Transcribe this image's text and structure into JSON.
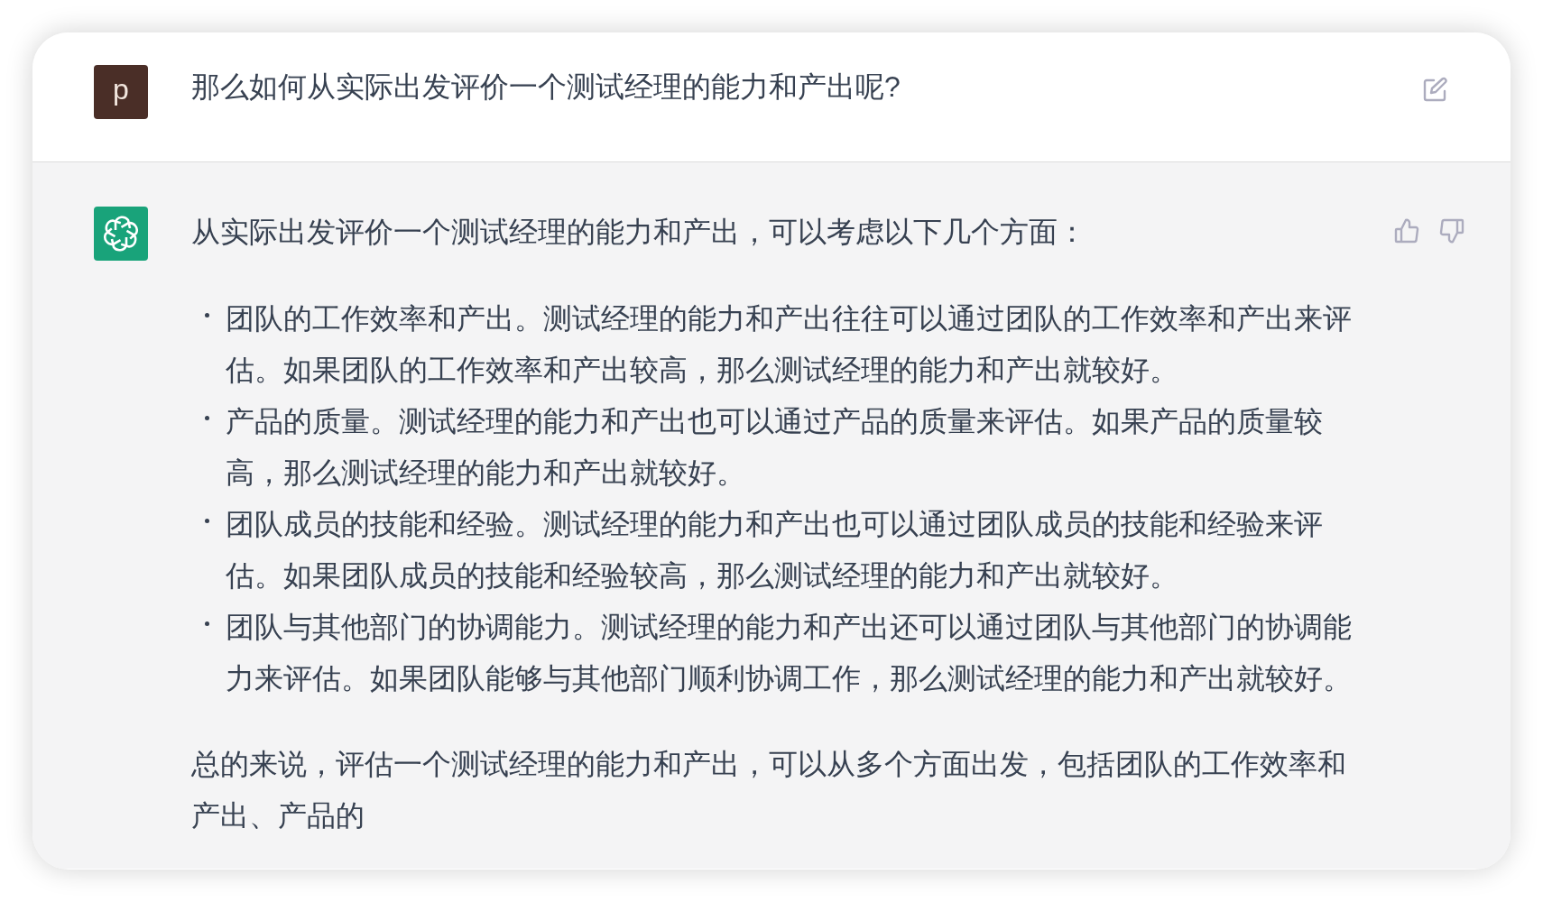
{
  "user_message": {
    "avatar_letter": "p",
    "text": "那么如何从实际出发评价一个测试经理的能力和产出呢?"
  },
  "assistant_message": {
    "intro": "从实际出发评价一个测试经理的能力和产出，可以考虑以下几个方面：",
    "bullets": [
      "团队的工作效率和产出。测试经理的能力和产出往往可以通过团队的工作效率和产出来评估。如果团队的工作效率和产出较高，那么测试经理的能力和产出就较好。",
      "产品的质量。测试经理的能力和产出也可以通过产品的质量来评估。如果产品的质量较高，那么测试经理的能力和产出就较好。",
      "团队成员的技能和经验。测试经理的能力和产出也可以通过团队成员的技能和经验来评估。如果团队成员的技能和经验较高，那么测试经理的能力和产出就较好。",
      "团队与其他部门的协调能力。测试经理的能力和产出还可以通过团队与其他部门的协调能力来评估。如果团队能够与其他部门顺利协调工作，那么测试经理的能力和产出就较好。"
    ],
    "conclusion": "总的来说，评估一个测试经理的能力和产出，可以从多个方面出发，包括团队的工作效率和产出、产品的"
  }
}
